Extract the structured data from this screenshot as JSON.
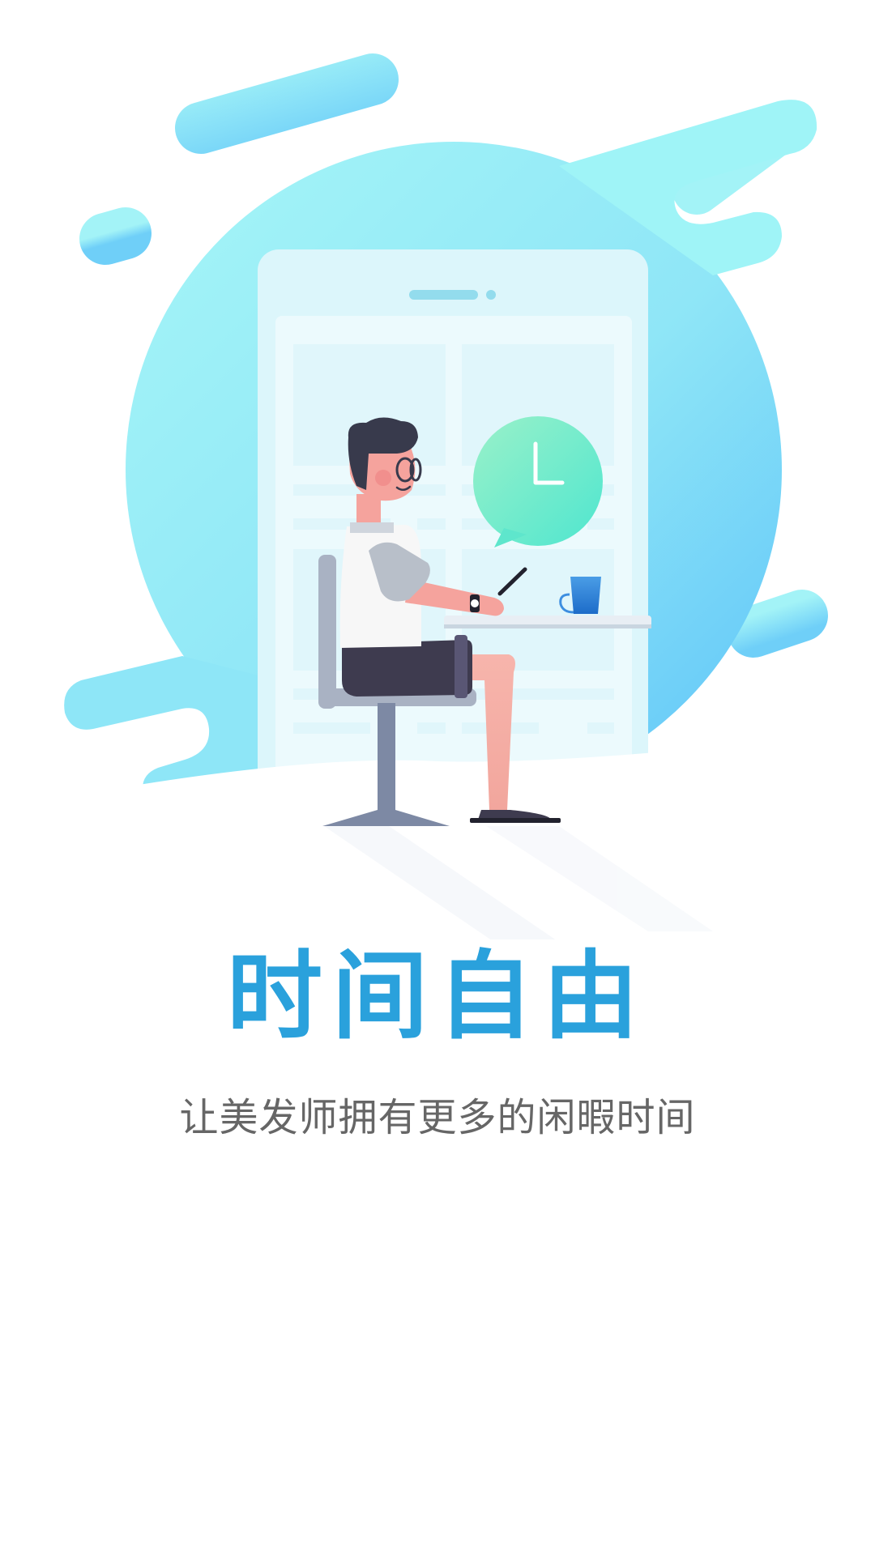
{
  "onboarding": {
    "title": "时间自由",
    "subtitle": "让美发师拥有更多的闲暇时间",
    "illustration": "person-working-on-phone-with-clock",
    "colors": {
      "title": "#2aa1dc",
      "subtitle": "#666666",
      "accent_blue": "#6dcff8",
      "accent_cyan": "#9ff5f7",
      "clock_green": "#5fe8c5"
    }
  }
}
